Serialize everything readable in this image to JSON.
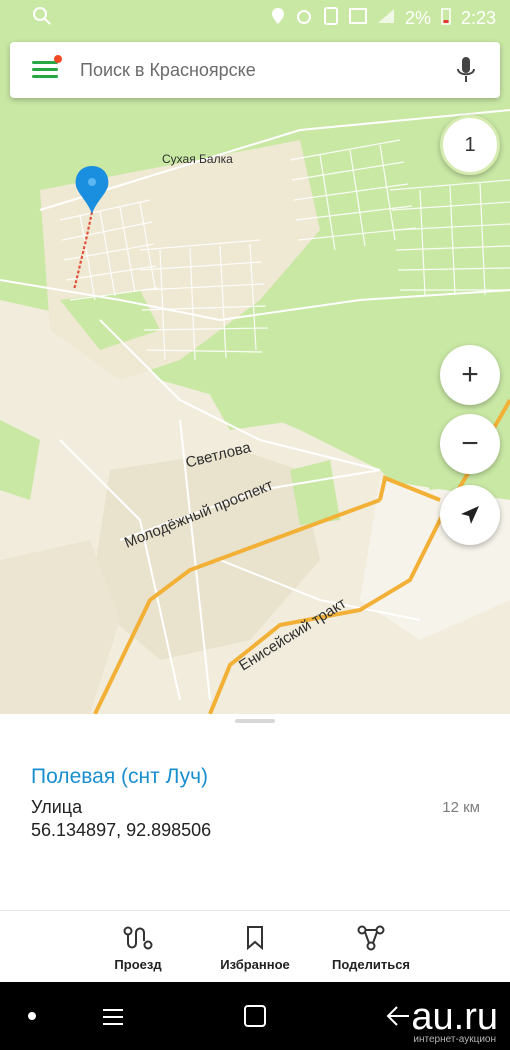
{
  "status_bar": {
    "battery": "2%",
    "time": "2:23"
  },
  "search": {
    "placeholder": "Поиск в Красноярске"
  },
  "map_controls": {
    "layer_badge": "1",
    "zoom_in": "+",
    "zoom_out": "−"
  },
  "map_labels": {
    "sukhaya_balka": "Сухая Балка",
    "svetlova": "Светлова",
    "molodezhny": "Молодёжный проспект",
    "eniseysky": "Енисейский тракт"
  },
  "place": {
    "title": "Полевая (снт Луч)",
    "type": "Улица",
    "coordinates": "56.134897, 92.898506",
    "distance": "12 км"
  },
  "actions": [
    {
      "label": "Проезд",
      "icon": "route-icon"
    },
    {
      "label": "Избранное",
      "icon": "bookmark-icon"
    },
    {
      "label": "Поделиться",
      "icon": "share-icon"
    }
  ],
  "watermark": {
    "main": "au.ru",
    "sub": "интернет-аукцион"
  },
  "colors": {
    "accent_green": "#27a844",
    "title_blue": "#1a8fd0",
    "road_orange": "#f2b136",
    "forest_green": "#c9e8a4",
    "urban": "#efe9d7"
  }
}
